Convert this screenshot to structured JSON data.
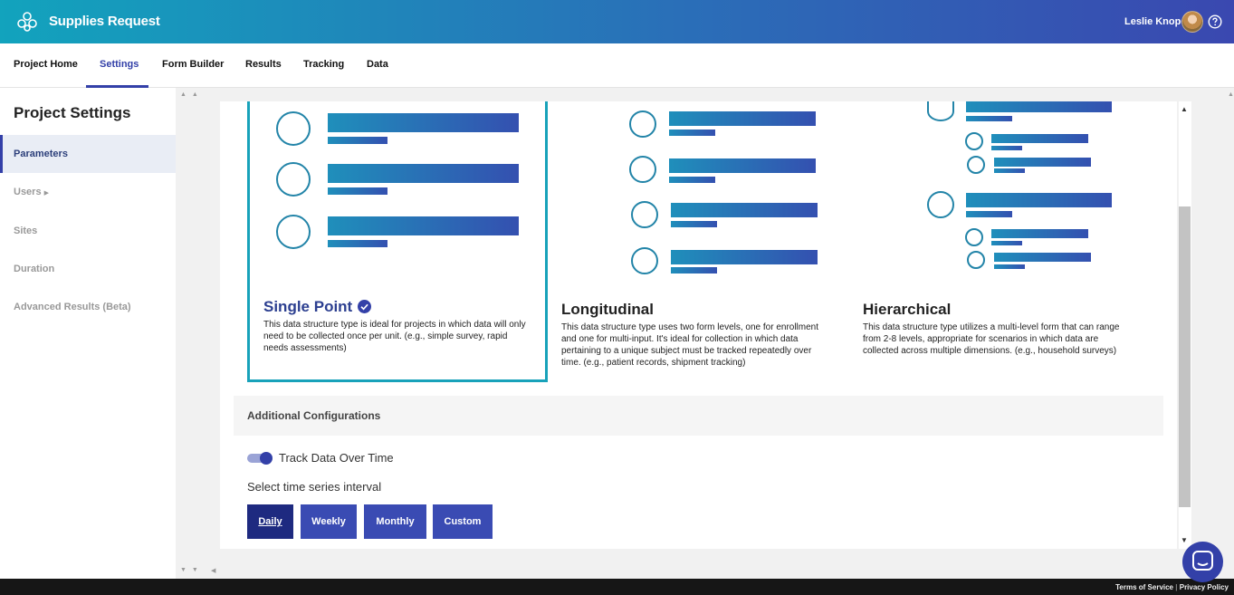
{
  "header": {
    "app_title": "Supplies Request",
    "user_name": "Leslie Knope"
  },
  "nav": {
    "tabs": [
      {
        "label": "Project Home"
      },
      {
        "label": "Settings"
      },
      {
        "label": "Form Builder"
      },
      {
        "label": "Results"
      },
      {
        "label": "Tracking"
      },
      {
        "label": "Data"
      }
    ],
    "active_tab": "Settings"
  },
  "sidebar": {
    "title": "Project Settings",
    "items": [
      {
        "label": "Parameters"
      },
      {
        "label": "Users"
      },
      {
        "label": "Sites"
      },
      {
        "label": "Duration"
      },
      {
        "label": "Advanced Results (Beta)"
      }
    ],
    "active_item": "Parameters"
  },
  "data_structure": {
    "options": [
      {
        "title": "Single Point",
        "description": "This data structure type is ideal for projects in which data will only need to be collected once per unit. (e.g., simple survey, rapid needs assessments)"
      },
      {
        "title": "Longitudinal",
        "description": "This data structure type uses two form levels, one for enrollment and one for multi-input. It's ideal for collection in which data pertaining to a unique subject must be tracked repeatedly over time. (e.g., patient records, shipment tracking)"
      },
      {
        "title": "Hierarchical",
        "description": "This data structure type utilizes a multi-level form that can range from 2-8 levels, appropriate for scenarios in which data are collected across multiple dimensions. (e.g., household surveys)"
      }
    ],
    "selected": "Single Point"
  },
  "additional": {
    "title": "Additional Configurations",
    "track_label": "Track Data Over Time",
    "track_on": true,
    "interval_label": "Select time series interval",
    "intervals": [
      {
        "label": "Daily"
      },
      {
        "label": "Weekly"
      },
      {
        "label": "Monthly"
      },
      {
        "label": "Custom"
      }
    ],
    "selected_interval": "Daily"
  },
  "footer": {
    "terms": "Terms of Service",
    "separator": "|",
    "privacy": "Privacy Policy"
  },
  "colors": {
    "primary": "#3340a8",
    "accent": "#18a2ba"
  }
}
